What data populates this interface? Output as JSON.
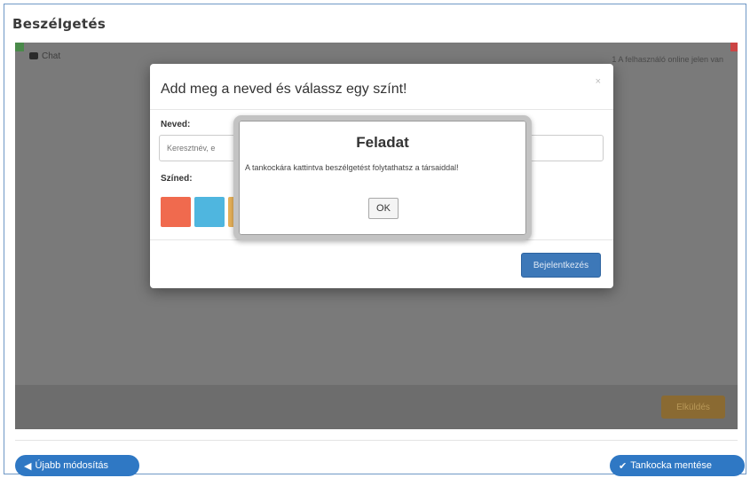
{
  "page": {
    "title": "Beszélgetés"
  },
  "chat": {
    "label": "Chat",
    "online_status": "1 A felhasználó online jelen van",
    "send_button": "Elküldés",
    "chat_icon": "chat-bubble-icon"
  },
  "modal": {
    "title": "Add meg a neved és válassz egy színt!",
    "close": "×",
    "name_label": "Neved:",
    "name_placeholder": "Keresztnév, e",
    "color_label": "Színed:",
    "colors": [
      "#f06a4e",
      "#4fb6df",
      "#e8b25a"
    ],
    "connect_button": "Bejelentkezés"
  },
  "alert": {
    "title": "Feladat",
    "message": "A tankockára kattintva beszélgetést folytathatsz a társaiddal!",
    "ok_button": "OK"
  },
  "footer": {
    "left_button": "Újabb módosítás",
    "left_icon": "arrow-left-icon",
    "right_button": "Tankocka mentése",
    "right_icon": "checkmark-icon"
  },
  "colors": {
    "primary_blue": "#2f78c4",
    "overlay_gray": "#7a7a7a",
    "send_brown": "#8a6a32",
    "frame_border": "#6f98c6"
  }
}
